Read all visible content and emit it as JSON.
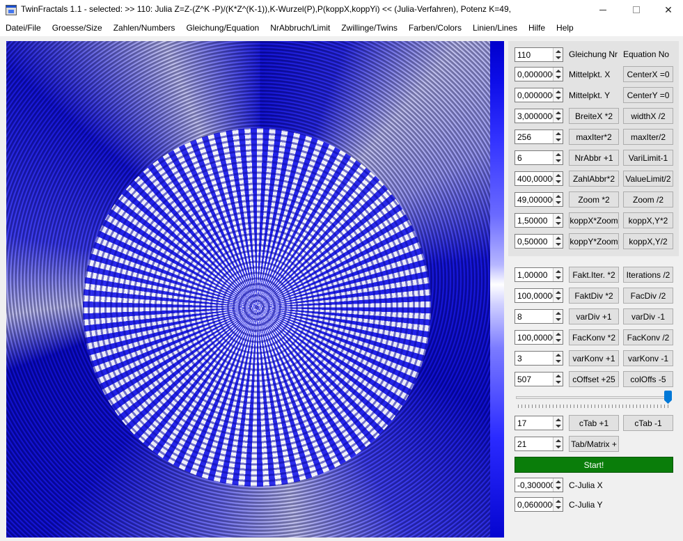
{
  "window": {
    "title": "TwinFractals 1.1 - selected: >> 110: Julia Z=Z-(Z^K -P)/(K*Z^(K-1)),K-Wurzel(P),P(koppX,koppYi)  << (Julia-Verfahren), Potenz K=49,",
    "close_glyph": "✕"
  },
  "menu": [
    "Datei/File",
    "Groesse/Size",
    "Zahlen/Numbers",
    "Gleichung/Equation",
    "NrAbbruch/Limit",
    "Zwillinge/Twins",
    "Farben/Colors",
    "Linien/Lines",
    "Hilfe",
    "Help"
  ],
  "panel": {
    "rows_top": [
      {
        "value": "110",
        "label_de": "Gleichung Nr",
        "label_en": "Equation No"
      },
      {
        "value": "0,0000000",
        "label_de": "Mittelpkt. X",
        "btn2": "CenterX =0"
      },
      {
        "value": "0,0000000",
        "label_de": "Mittelpkt. Y",
        "btn2": "CenterY =0"
      },
      {
        "value": "3,0000000",
        "btn1": "BreiteX *2",
        "btn2": "widthX /2"
      },
      {
        "value": "256",
        "btn1": "maxIter*2",
        "btn2": "maxIter/2"
      },
      {
        "value": "6",
        "btn1": "NrAbbr +1",
        "btn2": "VariLimit-1"
      },
      {
        "value": "400,00000",
        "btn1": "ZahlAbbr*2",
        "btn2": "ValueLimit/2"
      },
      {
        "value": "49,000000",
        "btn1": "Zoom *2",
        "btn2": "Zoom /2"
      },
      {
        "value": "1,50000",
        "btn1": "koppX*Zoom",
        "btn2": "koppX,Y*2"
      },
      {
        "value": "0,50000",
        "btn1": "koppY*Zoom",
        "btn2": "koppX,Y/2"
      }
    ],
    "rows_mid": [
      {
        "value": "1,00000",
        "btn1": "Fakt.Iter. *2",
        "btn2": "Iterations /2"
      },
      {
        "value": "100,00000",
        "btn1": "FaktDiv *2",
        "btn2": "FacDiv /2"
      },
      {
        "value": "8",
        "btn1": "varDiv +1",
        "btn2": "varDiv -1"
      },
      {
        "value": "100,00000",
        "btn1": "FacKonv *2",
        "btn2": "FacKonv /2"
      },
      {
        "value": "3",
        "btn1": "varKonv +1",
        "btn2": "varKonv -1"
      },
      {
        "value": "507",
        "btn1": "cOffset +25",
        "btn2": "colOffs -5"
      }
    ],
    "slider_value": 100,
    "rows_low": [
      {
        "value": "17",
        "btn1": "cTab +1",
        "btn2": "cTab -1"
      },
      {
        "value": "21",
        "btn1": "Tab/Matrix +"
      }
    ],
    "start_label": "Start!",
    "julia": [
      {
        "value": "-0,3000000",
        "label": "C-Julia X"
      },
      {
        "value": "0,0600000",
        "label": "C-Julia Y"
      }
    ]
  },
  "colors": {
    "start": "#0a7d0a",
    "fractal": "#1a1aee",
    "slider": "#0078d7"
  }
}
